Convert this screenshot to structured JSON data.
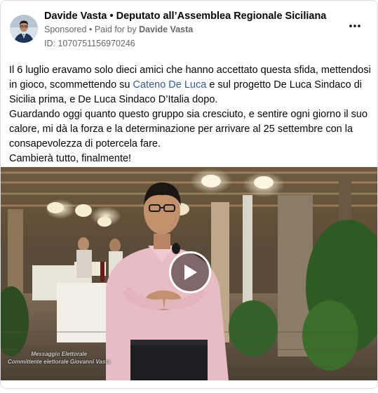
{
  "post": {
    "page_name": "Davide Vasta • Deputato all’Assemblea Regionale Siciliana",
    "sponsored_label": "Sponsored",
    "separator": "•",
    "paid_for_prefix": "Paid for by",
    "paid_for_name": "Davide Vasta",
    "id_label": "ID: 1070751156970246",
    "more_icon": "more-horizontal-icon",
    "text": {
      "p1_before": "Il 6 luglio eravamo solo dieci amici che hanno accettato questa sfida, mettendosi in gioco, scommettendo su ",
      "mention": "Cateno De Luca",
      "p1_after": " e sul progetto De Luca Sindaco di Sicilia prima, e De Luca Sindaco D’Italia dopo.",
      "p2": "Guardando oggi quanto questo gruppo sia cresciuto, e sentire ogni giorno il suo calore, mi dà la forza e la determinazione per arrivare al 25 settembre con la consapevolezza di potercela fare.",
      "p3": "Cambierà tutto, finalmente!"
    },
    "video": {
      "play_icon": "play-icon",
      "caption_line1": "Messaggio Elettorale",
      "caption_line2": "Committente elettorale Giovanni Vasta"
    }
  },
  "colors": {
    "text_primary": "#050505",
    "text_secondary": "#65676b",
    "mention": "#385898",
    "border": "#dadde1"
  }
}
